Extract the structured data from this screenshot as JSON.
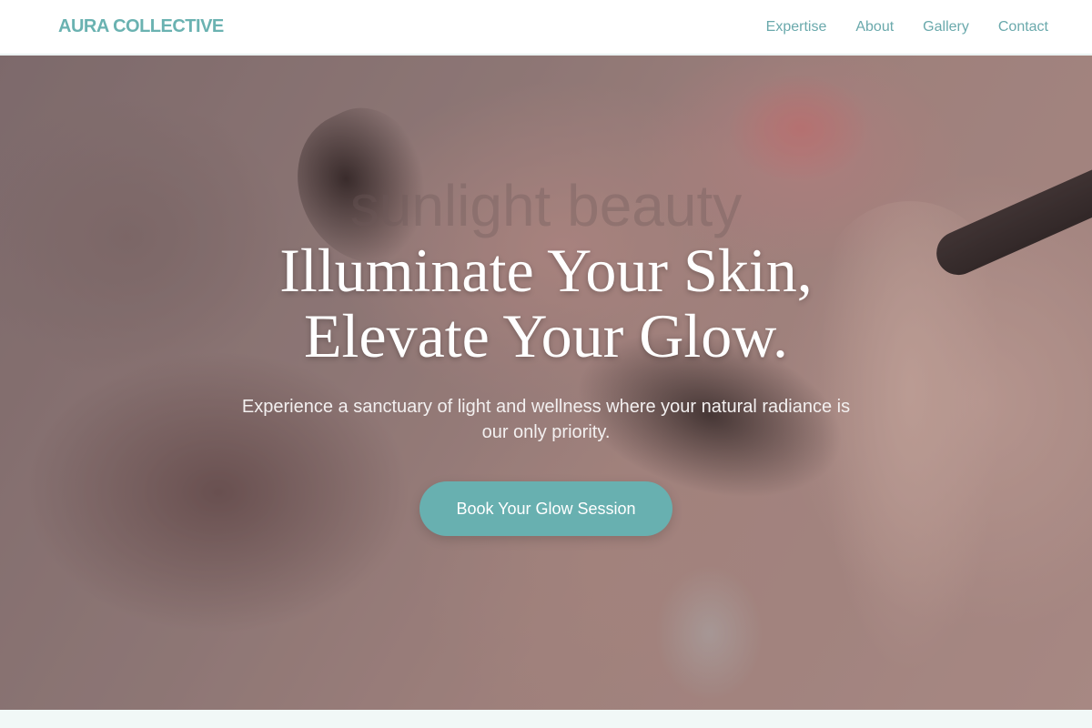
{
  "nav": {
    "brand": "AURA COLLECTIVE",
    "links": [
      "Expertise",
      "About",
      "Gallery",
      "Contact"
    ]
  },
  "hero": {
    "title_line1": "Illuminate Your Skin,",
    "title_line2": "Elevate Your Glow.",
    "watermark": "sunlight beauty",
    "subtitle": "Experience a sanctuary of light and wellness where your natural radiance is our only priority.",
    "cta_label": "Book Your Glow Session"
  },
  "colors": {
    "accent": "#68b0b0",
    "brand": "#6ab2b1",
    "nav_link": "#6aa9ac",
    "section_bg": "#f1f8f7"
  }
}
